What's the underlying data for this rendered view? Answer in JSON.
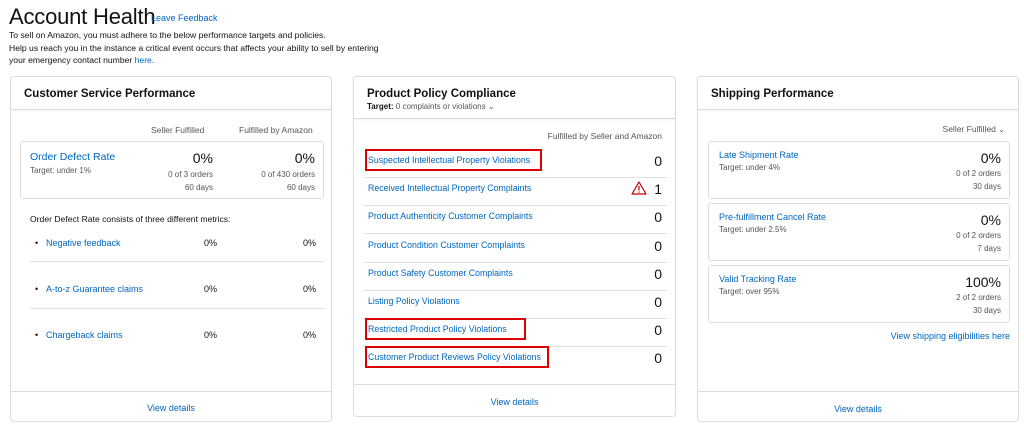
{
  "header": {
    "title": "Account Health",
    "feedback_link": "Leave Feedback",
    "intro_line1": "To sell on Amazon, you must adhere to the below performance targets and policies.",
    "intro_line2": "Help us reach you in the instance a critical event occurs that affects your ability to sell by entering",
    "intro_line3_text": "your emergency contact number",
    "intro_link": "here",
    "intro_end": "."
  },
  "csp": {
    "title": "Customer Service Performance",
    "col_seller": "Seller Fulfilled",
    "col_amazon": "Fulfilled by Amazon",
    "odr": {
      "label": "Order Defect Rate",
      "target": "Target: under 1%",
      "seller_pct": "0%",
      "seller_orders": "0 of 3 orders",
      "seller_days": "60 days",
      "amazon_pct": "0%",
      "amazon_orders": "0 of 430 orders",
      "amazon_days": "60 days"
    },
    "metrics_intro": "Order Defect Rate consists of three different metrics:",
    "metrics": [
      {
        "label": "Negative feedback",
        "seller": "0%",
        "amazon": "0%"
      },
      {
        "label": "A-to-z Guarantee claims",
        "seller": "0%",
        "amazon": "0%"
      },
      {
        "label": "Chargeback claims",
        "seller": "0%",
        "amazon": "0%"
      }
    ],
    "view_details": "View details"
  },
  "ppc": {
    "title": "Product Policy Compliance",
    "target_label": "Target:",
    "target_value": "0 complaints or violations",
    "chevron": "chevron-down-icon",
    "col_header": "Fulfilled by Seller and Amazon",
    "rows": [
      {
        "label": "Suspected Intellectual Property Violations",
        "value": "0"
      },
      {
        "label": "Received Intellectual Property Complaints",
        "value": "1"
      },
      {
        "label": "Product Authenticity Customer Complaints",
        "value": "0"
      },
      {
        "label": "Product Condition Customer Complaints",
        "value": "0"
      },
      {
        "label": "Product Safety Customer Complaints",
        "value": "0"
      },
      {
        "label": "Listing Policy Violations",
        "value": "0"
      },
      {
        "label": "Restricted Product Policy Violations",
        "value": "0"
      },
      {
        "label": "Customer Product Reviews Policy Violations",
        "value": "0"
      }
    ],
    "warning_icon": "warning-icon",
    "warning_color": "#c40000",
    "view_details": "View details"
  },
  "ship": {
    "title": "Shipping Performance",
    "filter": "Seller Fulfilled",
    "cards": [
      {
        "label": "Late Shipment Rate",
        "target": "Target: under 4%",
        "pct": "0%",
        "orders": "0 of 2 orders",
        "days": "30 days"
      },
      {
        "label": "Pre-fulfillment Cancel Rate",
        "target": "Target: under 2.5%",
        "pct": "0%",
        "orders": "0 of 2 orders",
        "days": "7 days"
      },
      {
        "label": "Valid Tracking Rate",
        "target": "Target: over 95%",
        "pct": "100%",
        "orders": "2 of 2 orders",
        "days": "30 days"
      }
    ],
    "eligibility_link": "View shipping eligibilities here",
    "view_details": "View details"
  },
  "colors": {
    "link": "#0066c0",
    "highlight_box": "#dd0000"
  }
}
